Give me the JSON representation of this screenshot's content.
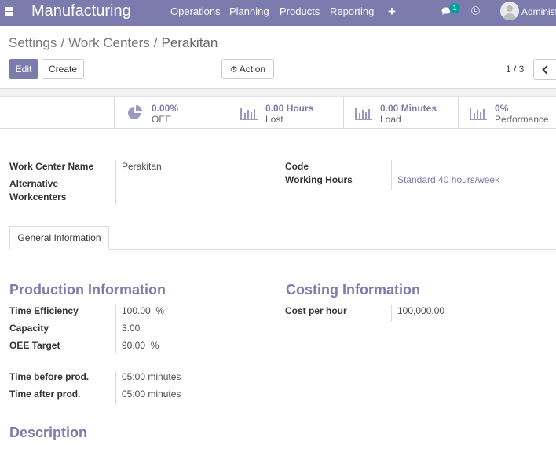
{
  "navbar": {
    "apps_icon": "apps-grid-icon",
    "brand": "Manufacturing",
    "menu": [
      "Operations",
      "Planning",
      "Products",
      "Reporting"
    ],
    "plus_icon": "+",
    "chat_badge": "1",
    "user_name": "Administrator"
  },
  "breadcrumb": {
    "items": [
      "Settings",
      "Work Centers"
    ],
    "current": "Perakitan",
    "separator": "/"
  },
  "buttons": {
    "edit": "Edit",
    "create": "Create",
    "action": "Action"
  },
  "pager": {
    "value": "1 / 3"
  },
  "stats": [
    {
      "value": "0.00%",
      "label": "OEE",
      "icon": "pie-chart-icon"
    },
    {
      "value": "0.00 Hours",
      "label": "Lost",
      "icon": "bar-chart-icon"
    },
    {
      "value": "0.00 Minutes",
      "label": "Load",
      "icon": "bar-chart-icon"
    },
    {
      "value": "0%",
      "label": "Performance",
      "icon": "bar-chart-icon"
    }
  ],
  "form": {
    "work_center_name_label": "Work Center Name",
    "work_center_name": "Perakitan",
    "alt_workcenters_label_1": "Alternative",
    "alt_workcenters_label_2": "Workcenters",
    "code_label": "Code",
    "code": "",
    "working_hours_label": "Working Hours",
    "working_hours": "Standard 40 hours/week"
  },
  "tabs": [
    "General Information"
  ],
  "production": {
    "title": "Production Information",
    "time_efficiency_label": "Time Efficiency",
    "time_efficiency": "100.00  %",
    "capacity_label": "Capacity",
    "capacity": "3.00",
    "oee_target_label": "OEE Target",
    "oee_target": "90.00  %",
    "time_before_label": "Time before prod.",
    "time_before": "05:00 minutes",
    "time_after_label": "Time after prod.",
    "time_after": "05:00 minutes"
  },
  "costing": {
    "title": "Costing Information",
    "cost_per_hour_label": "Cost per hour",
    "cost_per_hour": "100,000.00"
  },
  "description": {
    "title": "Description"
  },
  "colors": {
    "primary": "#7c7bad",
    "teal_badge": "#00A09D"
  }
}
